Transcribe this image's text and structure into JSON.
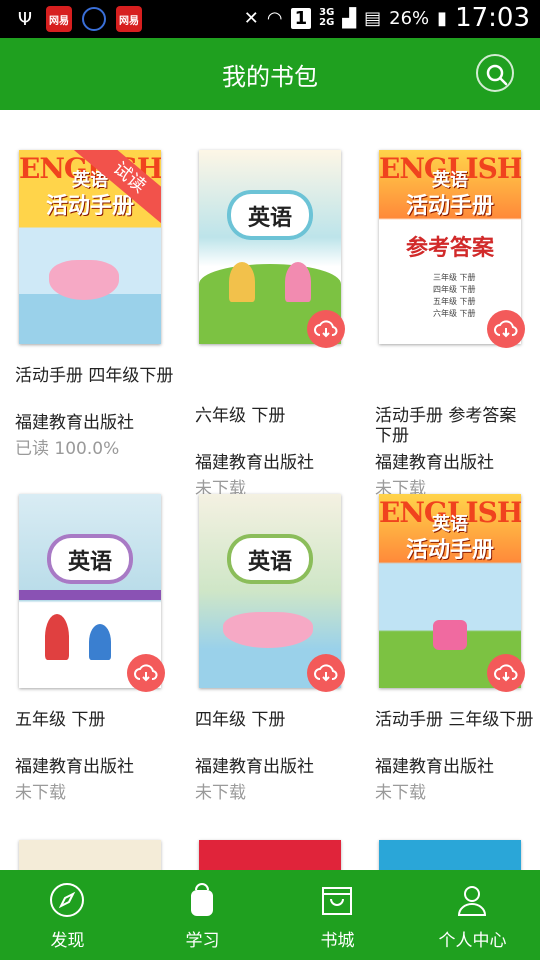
{
  "status_bar": {
    "app_icon_1": "网易",
    "app_icon_2": "网易",
    "network": "3G",
    "network2": "2G",
    "sim": "1",
    "battery": "26%",
    "time": "17:03"
  },
  "header": {
    "title": "我的书包"
  },
  "books": [
    {
      "name": "活动手册  四年级下册",
      "publisher": "福建教育出版社",
      "status": "已读 100.0%",
      "cover_english": "ENGLISH",
      "cover_title": "英语",
      "cover_sub": "活动手册",
      "ribbon": "试读"
    },
    {
      "name": "六年级  下册",
      "publisher": "福建教育出版社",
      "status": "未下载",
      "cover_title": "英语"
    },
    {
      "name": "活动手册  参考答案  下册",
      "publisher": "福建教育出版社",
      "status": "未下载",
      "cover_english": "ENGLISH",
      "cover_title": "英语",
      "cover_sub": "活动手册",
      "cover_answer": "参考答案",
      "answer_list": [
        "三年级 下册",
        "四年级 下册",
        "五年级 下册",
        "六年级 下册"
      ]
    },
    {
      "name": "五年级  下册",
      "publisher": "福建教育出版社",
      "status": "未下载",
      "cover_title": "英语"
    },
    {
      "name": "四年级  下册",
      "publisher": "福建教育出版社",
      "status": "未下载",
      "cover_title": "英语"
    },
    {
      "name": "活动手册  三年级下册",
      "publisher": "福建教育出版社",
      "status": "未下载",
      "cover_english": "ENGLISH",
      "cover_title": "英语",
      "cover_sub": "活动手册"
    }
  ],
  "tabs": [
    {
      "label": "发现",
      "icon": "compass-icon"
    },
    {
      "label": "学习",
      "icon": "backpack-icon"
    },
    {
      "label": "书城",
      "icon": "store-icon"
    },
    {
      "label": "个人中心",
      "icon": "person-icon"
    }
  ],
  "colors": {
    "primary": "#1fa01f",
    "download": "#f35a5a"
  }
}
